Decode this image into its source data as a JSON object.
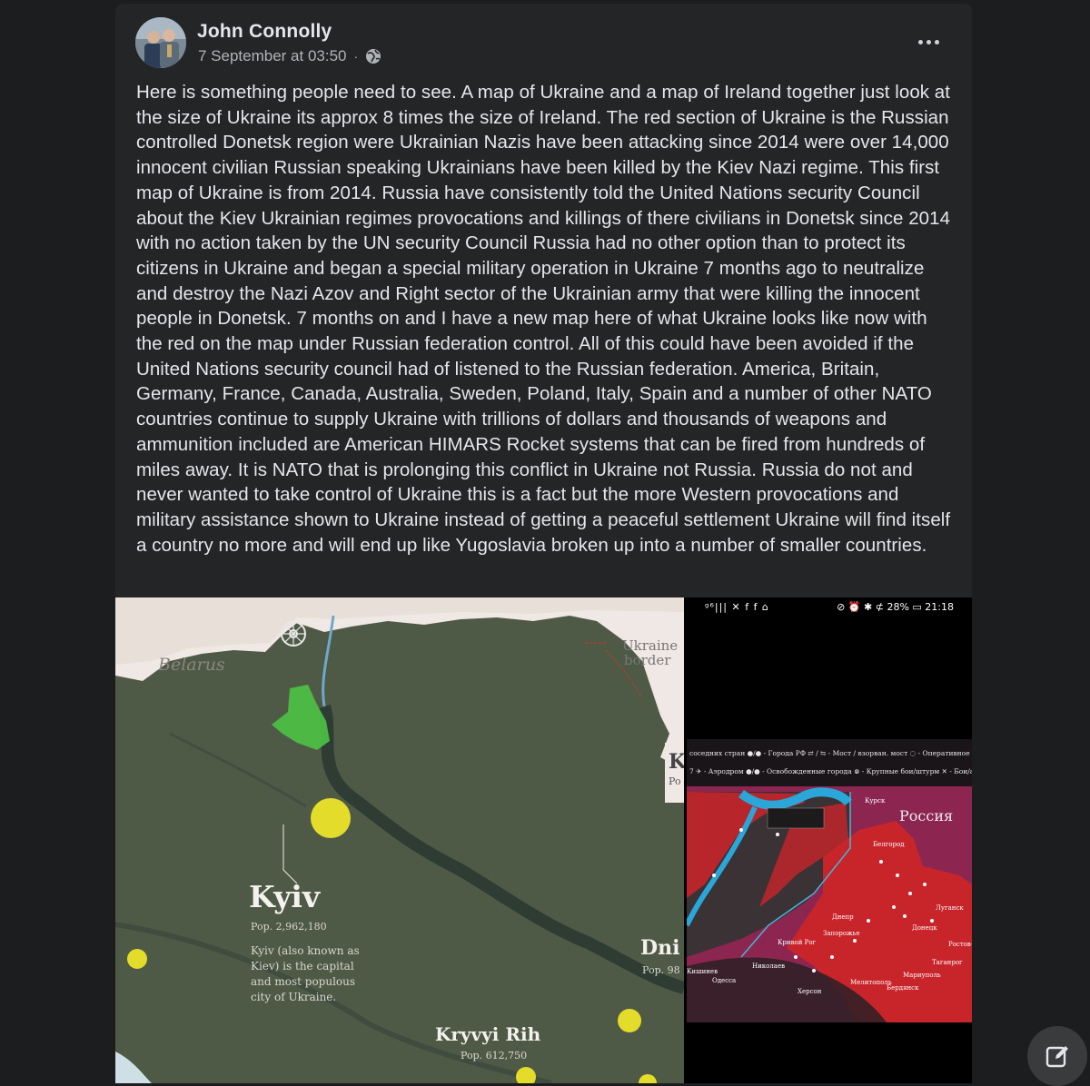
{
  "post": {
    "author": "John Connolly",
    "timestamp": "7 September at 03:50",
    "separator": "·",
    "visibility_icon": "globe-icon",
    "more_icon": "more-options-icon",
    "text": "Here is something people need to see. A map of Ukraine and a map of Ireland together just look at the size of Ukraine its approx 8 times the size of Ireland. The red section of Ukraine is the Russian controlled Donetsk region were Ukrainian Nazis have been attacking since 2014 were over 14,000 innocent civilian Russian speaking Ukrainians have been killed by the Kiev Nazi regime. This first map of Ukraine is from 2014. Russia have consistently told the United Nations security Council about the Kiev Ukrainian regimes provocations and killings of there civilians in Donetsk since 2014 with no action taken by the UN security Council Russia had no other option than to protect its citizens in Ukraine and began a special military operation in Ukraine 7 months ago to neutralize and destroy the Nazi Azov and Right sector of the Ukrainian army that were killing the innocent people in Donetsk. 7 months on and I have a new map here of what Ukraine looks like now with the red on the map under Russian federation control. All of this could have been avoided if the United Nations security council had of listened to the Russian federation. America, Britain, Germany, France, Canada, Australia, Sweden, Poland, Italy, Spain and a number of other NATO countries continue to supply Ukraine with trillions of dollars and thousands of weapons and ammunition included are American HIMARS Rocket systems that can be fired from hundreds of miles away. It is NATO that is prolonging this conflict in Ukraine not Russia. Russia do not and never wanted to take control of Ukraine this is a fact but the more Western provocations and military assistance shown to Ukraine instead of getting a peaceful settlement Ukraine will find itself a country no more and will end up like Yugoslavia broken up into a number of smaller countries."
  },
  "map_left": {
    "belarus": "Belarus",
    "border_label_1": "Ukraine",
    "border_label_2": "border",
    "kyiv_title": "Kyiv",
    "kyiv_pop": "Pop. 2,962,180",
    "kyiv_desc_1": "Kyiv (also known as",
    "kyiv_desc_2": "Kiev) is the capital",
    "kyiv_desc_3": "and most populous",
    "kyiv_desc_4": "city of Ukraine.",
    "dnipro_partial": "Dni",
    "dnipro_pop_partial": "Pop. 98",
    "kryvyi_title": "Kryvyi Rih",
    "kryvyi_pop": "Pop. 612,750",
    "k_partial": "K",
    "po_partial": "Po",
    "colors": {
      "land": "#4f5a46",
      "outside": "#f0e8e4",
      "green": "#4cc244",
      "yellow": "#e4dc2a",
      "river": "#2f3c34"
    }
  },
  "phone": {
    "status_left": "ᵍ⁶|||  ✕ f f ⌂",
    "status_right": "⊘ ⏰ ✱ ⊄ 28% ▭ 21:18",
    "legend_1": "соседних стран  ●/● - Города РФ    ⇄ / ⇆ - Мост / взорван. мост   ◌ - Оперативное окру",
    "legend_2": "7  ✈ - Аэродром   ●/● - Освобожденные города   ⊗ - Крупные бои/штурм   ✕ - Бои/атаки",
    "russia": "Россия",
    "cities": [
      "Курск",
      "Белгород",
      "Днепр",
      "Запорожье",
      "Донецк",
      "Луганск",
      "Ростов-н",
      "Кривой Рог",
      "Николаев",
      "Херсон",
      "Мелитополь",
      "Мариуполь",
      "Таганрог",
      "Бердянск",
      "Одесса",
      "Кишинев"
    ],
    "colors": {
      "russia": "#9a2a55",
      "controlled": "#c8252b",
      "ukraine": "#3a3235",
      "water": "#2aa6d8"
    }
  },
  "fab": {
    "icon": "compose-icon"
  }
}
